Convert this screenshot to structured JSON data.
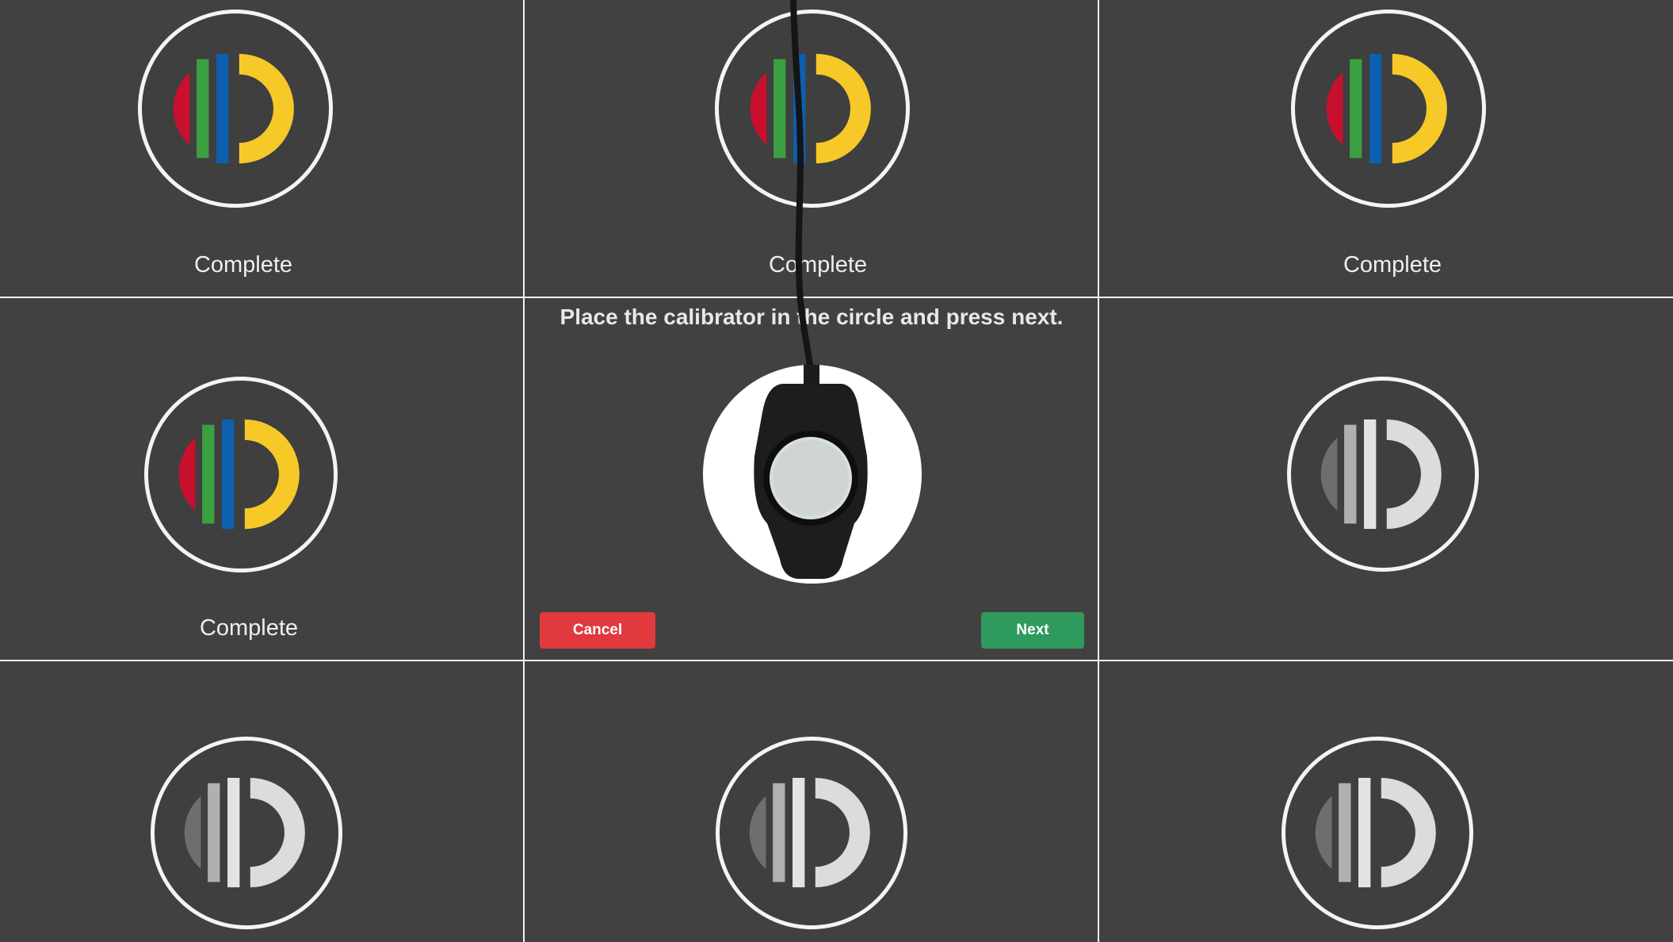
{
  "cells": [
    {
      "id": "top-left",
      "status": "Complete",
      "state": "complete"
    },
    {
      "id": "top-center",
      "status": "Complete",
      "state": "complete"
    },
    {
      "id": "top-right",
      "status": "Complete",
      "state": "complete"
    },
    {
      "id": "middle-left",
      "status": "Complete",
      "state": "complete"
    },
    {
      "id": "middle-right",
      "status": "",
      "state": "pending"
    },
    {
      "id": "bottom-left",
      "status": "",
      "state": "pending"
    },
    {
      "id": "bottom-center",
      "status": "",
      "state": "pending"
    },
    {
      "id": "bottom-right",
      "status": "",
      "state": "pending"
    }
  ],
  "active_cell": {
    "instruction": "Place the calibrator in the circle and press next.",
    "cancel_label": "Cancel",
    "next_label": "Next"
  },
  "colors": {
    "background": "#414141",
    "grid_line": "#f2f2f2",
    "cancel": "#e0393e",
    "next": "#2f9a5e",
    "logo_red": "#c8102e",
    "logo_green": "#3aa040",
    "logo_blue": "#0d5fb0",
    "logo_yellow": "#f6c928",
    "logo_gray": "#d6d6d6"
  },
  "icons": {
    "complete_target": "calibration-logo-color-icon",
    "pending_target": "calibration-logo-gray-icon",
    "device": "colorimeter-device-icon"
  }
}
